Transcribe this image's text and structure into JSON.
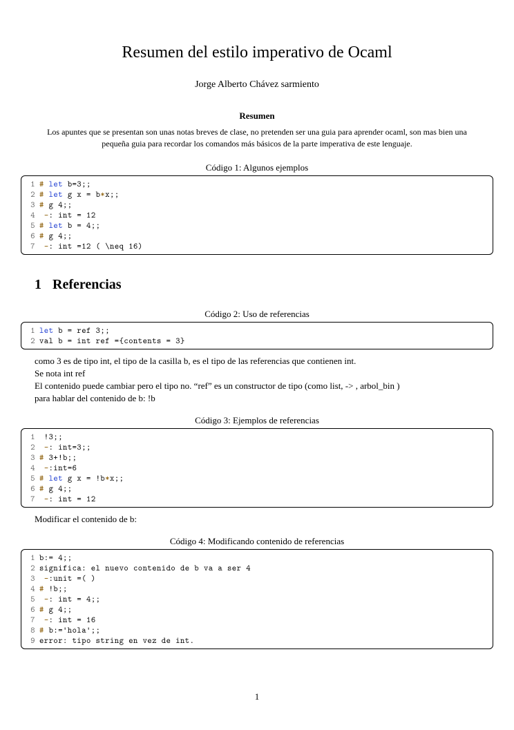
{
  "title": "Resumen del estilo imperativo de Ocaml",
  "author": "Jorge Alberto Chávez sarmiento",
  "abstract": {
    "heading": "Resumen",
    "text": "Los apuntes que se presentan son unas notas breves de clase, no pretenden ser una guia para aprender ocaml, son mas bien una pequeña guia para recordar los comandos más básicos de la parte imperativa de este lenguaje."
  },
  "section1": {
    "number": "1",
    "title": "Referencias"
  },
  "listing1": {
    "caption": "Código 1: Algunos ejemplos",
    "lines": [
      {
        "n": "1",
        "tokens": [
          {
            "t": "# ",
            "c": "sym"
          },
          {
            "t": "let ",
            "c": "kw"
          },
          {
            "t": "b=3;;",
            "c": ""
          }
        ]
      },
      {
        "n": "2",
        "tokens": [
          {
            "t": "# ",
            "c": "sym"
          },
          {
            "t": "let ",
            "c": "kw"
          },
          {
            "t": "g x = b",
            "c": ""
          },
          {
            "t": "*",
            "c": "sym"
          },
          {
            "t": "x;;",
            "c": ""
          }
        ]
      },
      {
        "n": "3",
        "tokens": [
          {
            "t": "# ",
            "c": "sym"
          },
          {
            "t": "g 4;;",
            "c": ""
          }
        ]
      },
      {
        "n": "4",
        "tokens": [
          {
            "t": " ",
            "c": ""
          },
          {
            "t": "-",
            "c": "sym"
          },
          {
            "t": ": int = 12",
            "c": ""
          }
        ]
      },
      {
        "n": "5",
        "tokens": [
          {
            "t": "# ",
            "c": "sym"
          },
          {
            "t": "let ",
            "c": "kw"
          },
          {
            "t": "b = 4;;",
            "c": ""
          }
        ]
      },
      {
        "n": "6",
        "tokens": [
          {
            "t": "# ",
            "c": "sym"
          },
          {
            "t": "g 4;;",
            "c": ""
          }
        ]
      },
      {
        "n": "7",
        "tokens": [
          {
            "t": " ",
            "c": ""
          },
          {
            "t": "-",
            "c": "sym"
          },
          {
            "t": ": int =12 ( \\neq 16)",
            "c": ""
          }
        ]
      }
    ]
  },
  "listing2": {
    "caption": "Código 2: Uso de referencias",
    "lines": [
      {
        "n": "1",
        "tokens": [
          {
            "t": "let ",
            "c": "kw"
          },
          {
            "t": "b = ref 3;;",
            "c": ""
          }
        ]
      },
      {
        "n": "2",
        "tokens": [
          {
            "t": "val b = int ref ={contents = 3}",
            "c": ""
          }
        ]
      }
    ]
  },
  "para_after_l2": "como 3 es de tipo int, el tipo de la casilla b, es el tipo de las referencias que contienen int.\nSe nota int ref\nEl contenido puede cambiar pero el tipo no. “ref” es un constructor de tipo (como list, -> , arbol_bin )\npara hablar del contenido de b: !b",
  "listing3": {
    "caption": "Código 3: Ejemplos de referencias",
    "lines": [
      {
        "n": "1",
        "tokens": [
          {
            "t": " !3;;",
            "c": ""
          }
        ]
      },
      {
        "n": "2",
        "tokens": [
          {
            "t": " ",
            "c": ""
          },
          {
            "t": "-",
            "c": "sym"
          },
          {
            "t": ": int=3;;",
            "c": ""
          }
        ]
      },
      {
        "n": "3",
        "tokens": [
          {
            "t": "# ",
            "c": "sym"
          },
          {
            "t": "3+!b;;",
            "c": ""
          }
        ]
      },
      {
        "n": "4",
        "tokens": [
          {
            "t": " ",
            "c": ""
          },
          {
            "t": "-",
            "c": "sym"
          },
          {
            "t": ":int=6",
            "c": ""
          }
        ]
      },
      {
        "n": "5",
        "tokens": [
          {
            "t": "# ",
            "c": "sym"
          },
          {
            "t": "let ",
            "c": "kw"
          },
          {
            "t": "g x = !b",
            "c": ""
          },
          {
            "t": "*",
            "c": "sym"
          },
          {
            "t": "x;;",
            "c": ""
          }
        ]
      },
      {
        "n": "6",
        "tokens": [
          {
            "t": "# ",
            "c": "sym"
          },
          {
            "t": "g 4;;",
            "c": ""
          }
        ]
      },
      {
        "n": "7",
        "tokens": [
          {
            "t": " ",
            "c": ""
          },
          {
            "t": "-",
            "c": "sym"
          },
          {
            "t": ": int = 12",
            "c": ""
          }
        ]
      }
    ]
  },
  "para_after_l3": "Modificar el contenido de b:",
  "listing4": {
    "caption": "Código 4: Modificando contenido de referencias",
    "lines": [
      {
        "n": "1",
        "tokens": [
          {
            "t": "b:= 4;;",
            "c": ""
          }
        ]
      },
      {
        "n": "2",
        "tokens": [
          {
            "t": "significa: el nuevo contenido de b va a ser 4",
            "c": ""
          }
        ]
      },
      {
        "n": "3",
        "tokens": [
          {
            "t": " ",
            "c": ""
          },
          {
            "t": "-",
            "c": "sym"
          },
          {
            "t": ":unit =( )",
            "c": ""
          }
        ]
      },
      {
        "n": "4",
        "tokens": [
          {
            "t": "# ",
            "c": "sym"
          },
          {
            "t": "!b;;",
            "c": ""
          }
        ]
      },
      {
        "n": "5",
        "tokens": [
          {
            "t": " ",
            "c": ""
          },
          {
            "t": "-",
            "c": "sym"
          },
          {
            "t": ": int = 4;;",
            "c": ""
          }
        ]
      },
      {
        "n": "6",
        "tokens": [
          {
            "t": "# ",
            "c": "sym"
          },
          {
            "t": "g 4;;",
            "c": ""
          }
        ]
      },
      {
        "n": "7",
        "tokens": [
          {
            "t": " ",
            "c": ""
          },
          {
            "t": "-",
            "c": "sym"
          },
          {
            "t": ": int = 16",
            "c": ""
          }
        ]
      },
      {
        "n": "8",
        "tokens": [
          {
            "t": "# ",
            "c": "sym"
          },
          {
            "t": "b:='hola';;",
            "c": ""
          }
        ]
      },
      {
        "n": "9",
        "tokens": [
          {
            "t": "error: tipo string en vez de int.",
            "c": ""
          }
        ]
      }
    ]
  },
  "page_number": "1"
}
